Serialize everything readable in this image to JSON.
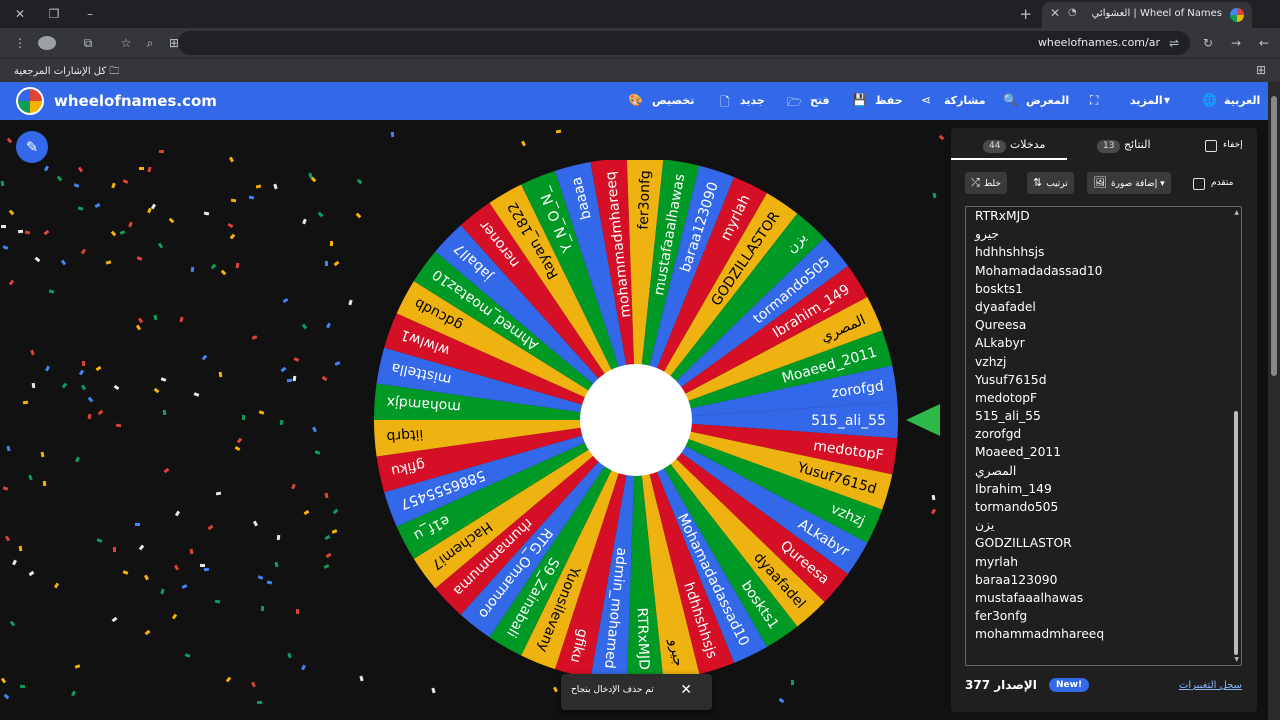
{
  "browser": {
    "tab_title": "العشوائي | Wheel of Names",
    "url": "wheelofnames.com/ar",
    "bookmarks_label": "كل الإشارات المرجعية"
  },
  "header": {
    "brand": "wheelofnames.com",
    "nav": {
      "customize": "تخصيص",
      "new": "جديد",
      "open": "فتح",
      "save": "حفظ",
      "share": "مشاركة",
      "gallery": "المعرض",
      "more": "المزيد",
      "language": "العربية"
    }
  },
  "panel": {
    "tabs": {
      "entries_label": "مدخلات",
      "entries_count": "44",
      "results_label": "النتائج",
      "results_count": "13",
      "hide_label": "إخفاء"
    },
    "toolbar": {
      "shuffle": "خلط",
      "sort": "ترتيب",
      "add_image": "إضافة صورة",
      "advanced": "متقدم"
    },
    "entries": [
      "RTRxMJD",
      "جيرو",
      "hdhhshhsjs",
      "Mohamadadassad10",
      "boskts1",
      "dyaafadel",
      "Qureesa",
      "ALkabyr",
      "vzhzj",
      "Yusuf7615d",
      "medotopF",
      "515_ali_55",
      "zorofgd",
      "Moaeed_2011",
      "المصري",
      "Ibrahim_149",
      "tormando505",
      "يزن",
      "GODZILLASTOR",
      "myrlah",
      "baraa123090",
      "mustafaaalhawas",
      "fer3onfg",
      "mohammadmhareeq"
    ],
    "version_label": "الإصدار",
    "version_number": "377",
    "new_badge": "New!",
    "changelog": "سجل التغييرات"
  },
  "toast": {
    "message": "تم حذف الإدخال بنجاح",
    "close": "✕"
  },
  "wheel": {
    "colors": [
      "#3369e8",
      "#d50f25",
      "#eeb211",
      "#009925"
    ],
    "segments": [
      "515_ali_55",
      "medotopF",
      "Yusuf7615d",
      "vzhzj",
      "ALkabyr",
      "Qureesa",
      "dyaafadel",
      "boskts1",
      "Mohamadadassad10",
      "hdhhshhsjs",
      "جيرو",
      "RTRxMJD",
      "admin_mohamed",
      "gfiku",
      "Yuonsilevany",
      "S9_Zainabali",
      "RTG_Omarmoro",
      "rhumammuma",
      "Hachemi7",
      "e1f_u",
      "5886555457",
      "gfiku",
      "iitqrb",
      "mohamdjx",
      "misttella",
      "wlwlw1",
      "gdcudb",
      "Ahmed_moataz10",
      "jaball7",
      "neroner",
      "Rayan_1822",
      "Y_N_O_N_",
      "baaaa",
      "mohammadmhareeq",
      "fer3onfg",
      "mustafaaalhawas",
      "baraa123090",
      "myrlah",
      "GODZILLASTOR",
      "يزن",
      "tormando505",
      "Ibrahim_149",
      "المصري",
      "Moaeed_2011",
      "zorofgd"
    ]
  }
}
